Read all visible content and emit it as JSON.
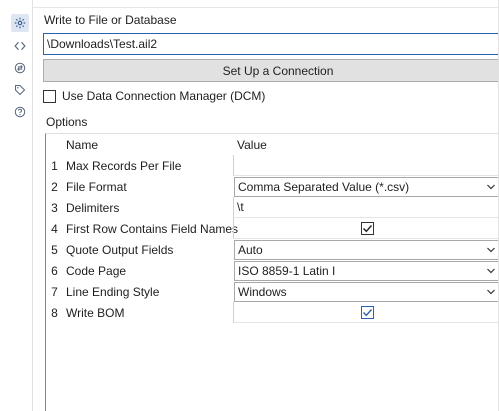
{
  "rail": {
    "items": [
      {
        "name": "configuration-gear-icon",
        "active": true
      },
      {
        "name": "code-brackets-icon",
        "active": false
      },
      {
        "name": "connection-arrows-icon",
        "active": false
      },
      {
        "name": "tag-icon",
        "active": false
      },
      {
        "name": "help-icon",
        "active": false
      }
    ]
  },
  "panel": {
    "title": "Write to File or Database",
    "path_value": "\\Downloads\\Test.ail2",
    "setup_button_label": "Set Up a Connection",
    "dcm_label": "Use Data Connection Manager (DCM)",
    "dcm_checked": false,
    "options_label": "Options"
  },
  "grid": {
    "header_name": "Name",
    "header_value": "Value",
    "rows": [
      {
        "num": "1",
        "name": "Max Records Per File",
        "value": "",
        "kind": "text"
      },
      {
        "num": "2",
        "name": "File Format",
        "value": "Comma Separated Value (*.csv)",
        "kind": "dropdown"
      },
      {
        "num": "3",
        "name": "Delimiters",
        "value": "\\t",
        "kind": "text"
      },
      {
        "num": "4",
        "name": "First Row Contains Field Names",
        "value": "",
        "kind": "checkbox",
        "checked": true
      },
      {
        "num": "5",
        "name": "Quote Output Fields",
        "value": "Auto",
        "kind": "dropdown"
      },
      {
        "num": "6",
        "name": "Code Page",
        "value": "ISO 8859-1 Latin I",
        "kind": "dropdown"
      },
      {
        "num": "7",
        "name": "Line Ending Style",
        "value": "Windows",
        "kind": "dropdown"
      },
      {
        "num": "8",
        "name": "Write BOM",
        "value": "",
        "kind": "checkbox",
        "checked": true
      }
    ]
  },
  "colors": {
    "accent": "#2b63b4",
    "rail_active_bg": "#dde6f2",
    "button_bg": "#e1e1e1"
  }
}
